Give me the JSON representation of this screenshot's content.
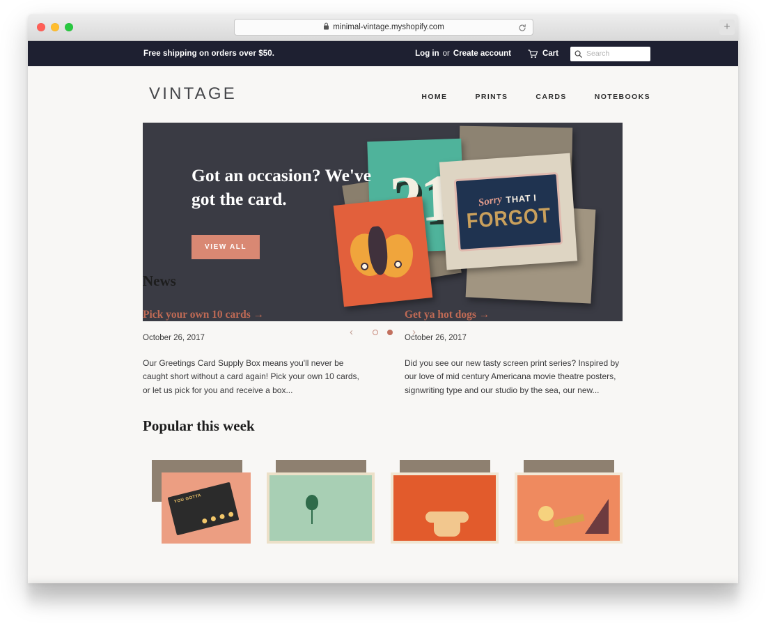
{
  "browser": {
    "url": "minimal-vintage.myshopify.com",
    "lock_icon": "lock-icon",
    "reload_icon": "reload-icon",
    "new_tab_label": "+",
    "traffic_lights": [
      "close",
      "minimize",
      "zoom"
    ]
  },
  "announcement": {
    "message": "Free shipping on orders over $50.",
    "login_label": "Log in",
    "separator": "or",
    "create_account_label": "Create account",
    "cart_label": "Cart",
    "cart_icon": "shopping-cart-icon",
    "search_placeholder": "Search",
    "search_value": "",
    "search_icon": "search-icon",
    "background_color": "#1e2031"
  },
  "header": {
    "logo": "VINTAGE",
    "nav": [
      {
        "label": "HOME"
      },
      {
        "label": "PRINTS"
      },
      {
        "label": "CARDS"
      },
      {
        "label": "NOTEBOOKS"
      }
    ]
  },
  "hero": {
    "title": "Got an occasion? We've got the card.",
    "button_label": "VIEW ALL",
    "button_color": "#d98873",
    "background_color": "#3a3b44",
    "image_alt": "greeting cards and kraft envelopes",
    "card_numeral": "21",
    "sign_sorry": "Sorry",
    "sign_that_i": "THAT I",
    "sign_forgot": "FORGOT",
    "prev_icon": "chevron-left-icon",
    "next_icon": "chevron-right-icon",
    "slides": [
      {
        "active": false
      },
      {
        "active": true
      }
    ]
  },
  "news": {
    "heading": "News",
    "articles": [
      {
        "title": "Pick your own 10 cards →",
        "date": "October 26, 2017",
        "excerpt": "Our Greetings Card Supply Box means you'll never be caught short without a card again! Pick your own 10 cards, or let us pick for you and receive a box..."
      },
      {
        "title": "Get ya hot dogs →",
        "date": "October 26, 2017",
        "excerpt": "Did you see our new tasty screen print series? Inspired by our love of mid century Americana movie theatre posters, signwriting type and our studio by the sea, our new..."
      }
    ]
  },
  "popular": {
    "heading": "Popular this week",
    "products": [
      {
        "swatch": "#ec9e82",
        "art": "cinema-sign",
        "marquee": "YOU GOTTA"
      },
      {
        "swatch": "#a8cfb4",
        "art": "balloon"
      },
      {
        "swatch": "#e25b2c",
        "art": "abstract-shape"
      },
      {
        "swatch": "#ef8a5f",
        "art": "fan-and-sun"
      }
    ]
  },
  "colors": {
    "accent": "#bf6a55",
    "page_background": "#f8f7f5",
    "dark": "#1e2031"
  }
}
